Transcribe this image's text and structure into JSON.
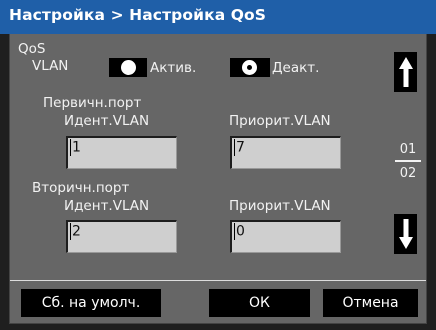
{
  "title": "Настройка > Настройка QoS",
  "qos_label": "QoS",
  "vlan_label": "VLAN",
  "vlan_options": {
    "active": "Актив.",
    "inactive": "Деакт."
  },
  "primary": {
    "section": "Первичн.порт",
    "id_label": "Идент.VLAN",
    "id_value": "1",
    "priority_label": "Приорит.VLAN",
    "priority_value": "7"
  },
  "secondary": {
    "section": "Вторичн.порт",
    "id_label": "Идент.VLAN",
    "id_value": "2",
    "priority_label": "Приорит.VLAN",
    "priority_value": "0"
  },
  "pager": {
    "current": "01",
    "total": "02"
  },
  "buttons": {
    "reset": "Сб. на умолч.",
    "ok": "ОК",
    "cancel": "Отмена"
  },
  "icons": {
    "up": "arrow-up-icon",
    "down": "arrow-down-icon"
  }
}
